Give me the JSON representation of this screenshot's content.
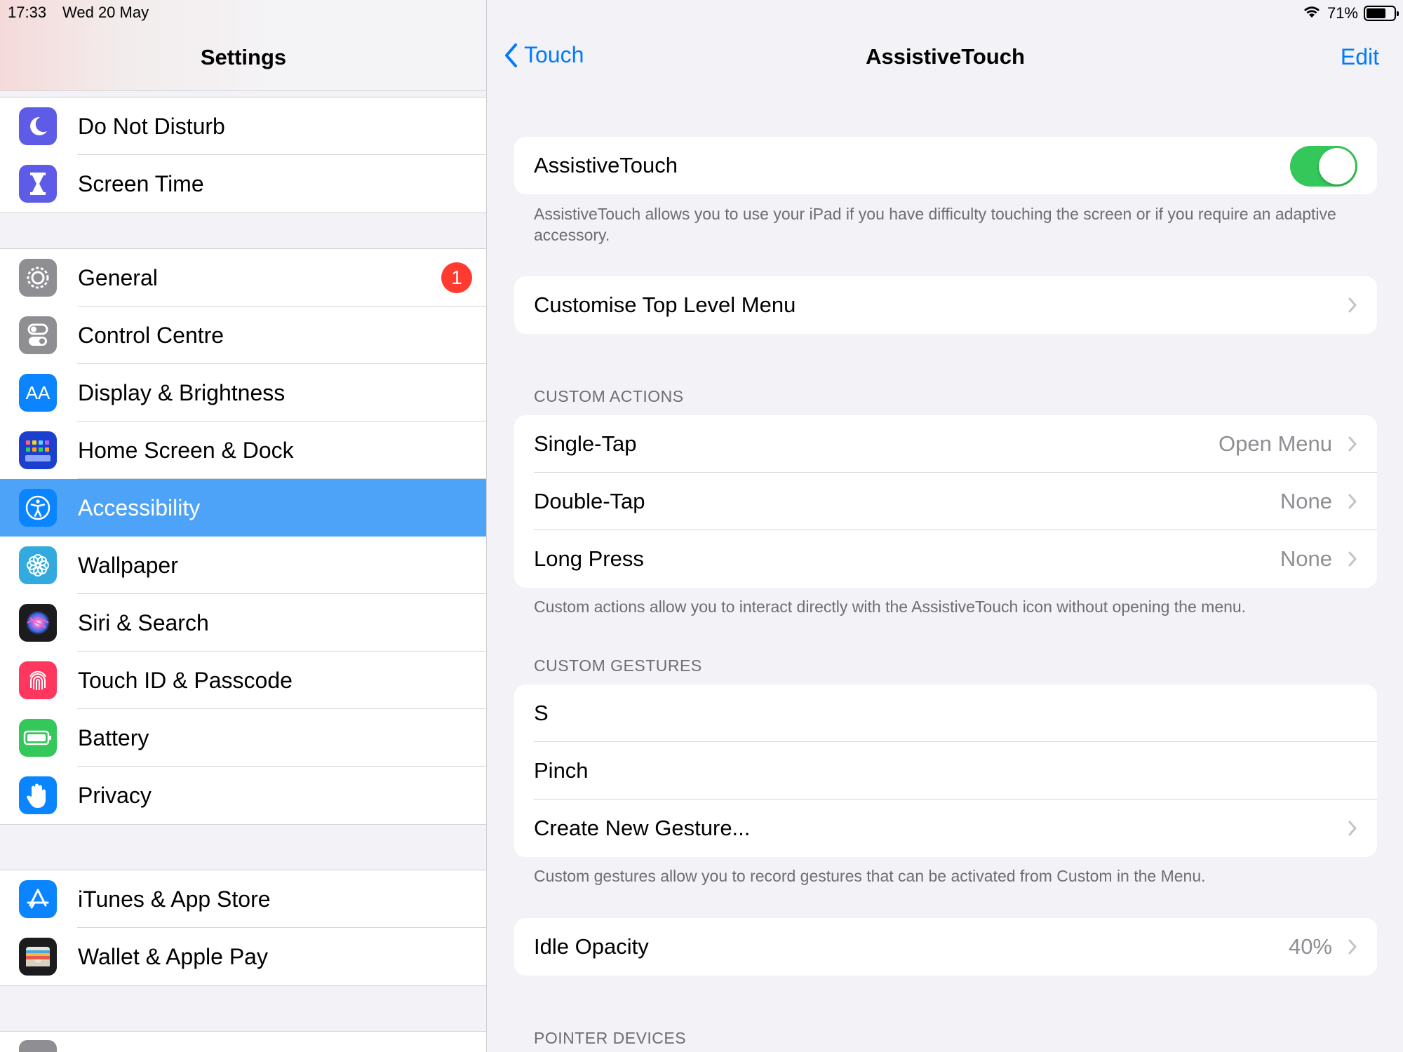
{
  "status_bar": {
    "time": "17:33",
    "date": "Wed 20 May",
    "battery": "71%",
    "battery_level": 0.71
  },
  "sidebar": {
    "title": "Settings",
    "group1": [
      {
        "label": "Do Not Disturb",
        "icon": "moon-icon",
        "color": "#5e5ce6"
      },
      {
        "label": "Screen Time",
        "icon": "hourglass-icon",
        "color": "#5e5ce6"
      }
    ],
    "group2": [
      {
        "label": "General",
        "icon": "gear-icon",
        "color": "#8e8e93",
        "badge": "1"
      },
      {
        "label": "Control Centre",
        "icon": "switches-icon",
        "color": "#8e8e93"
      },
      {
        "label": "Display & Brightness",
        "icon": "text-size-icon",
        "color": "#0a84ff",
        "glyph": "AA"
      },
      {
        "label": "Home Screen & Dock",
        "icon": "app-grid-icon",
        "color": "#1c3fcf"
      },
      {
        "label": "Accessibility",
        "icon": "accessibility-icon",
        "color": "#0a84ff",
        "selected": true
      },
      {
        "label": "Wallpaper",
        "icon": "flower-icon",
        "color": "#33aadd"
      },
      {
        "label": "Siri & Search",
        "icon": "siri-icon",
        "color": "#222"
      },
      {
        "label": "Touch ID & Passcode",
        "icon": "fingerprint-icon",
        "color": "#ff375f"
      },
      {
        "label": "Battery",
        "icon": "battery-icon",
        "color": "#34c759"
      },
      {
        "label": "Privacy",
        "icon": "hand-icon",
        "color": "#0a84ff"
      }
    ],
    "group3": [
      {
        "label": "iTunes & App Store",
        "icon": "app-store-icon",
        "color": "#0a84ff"
      },
      {
        "label": "Wallet & Apple Pay",
        "icon": "wallet-icon",
        "color": "#222"
      }
    ]
  },
  "detail": {
    "back_label": "Touch",
    "title": "AssistiveTouch",
    "edit_label": "Edit",
    "assistive": {
      "label": "AssistiveTouch",
      "enabled": true
    },
    "assistive_note": "AssistiveTouch allows you to use your iPad if you have difficulty touching the screen or if you require an adaptive accessory.",
    "customise_label": "Customise Top Level Menu",
    "custom_actions_header": "CUSTOM ACTIONS",
    "custom_actions": [
      {
        "label": "Single-Tap",
        "value": "Open Menu"
      },
      {
        "label": "Double-Tap",
        "value": "None"
      },
      {
        "label": "Long Press",
        "value": "None"
      }
    ],
    "custom_actions_note": "Custom actions allow you to interact directly with the AssistiveTouch icon without opening the menu.",
    "custom_gestures_header": "CUSTOM GESTURES",
    "custom_gestures": [
      "S",
      "Pinch",
      "Create New Gesture..."
    ],
    "custom_gestures_note": "Custom gestures allow you to record gestures that can be activated from Custom in the Menu.",
    "idle_opacity": {
      "label": "Idle Opacity",
      "value": "40%"
    },
    "pointer_header": "POINTER DEVICES"
  },
  "colors": {
    "accent": "#007aff",
    "selected_row": "#4da3f7",
    "toggle_on": "#34c759",
    "badge": "#ff3b30"
  }
}
